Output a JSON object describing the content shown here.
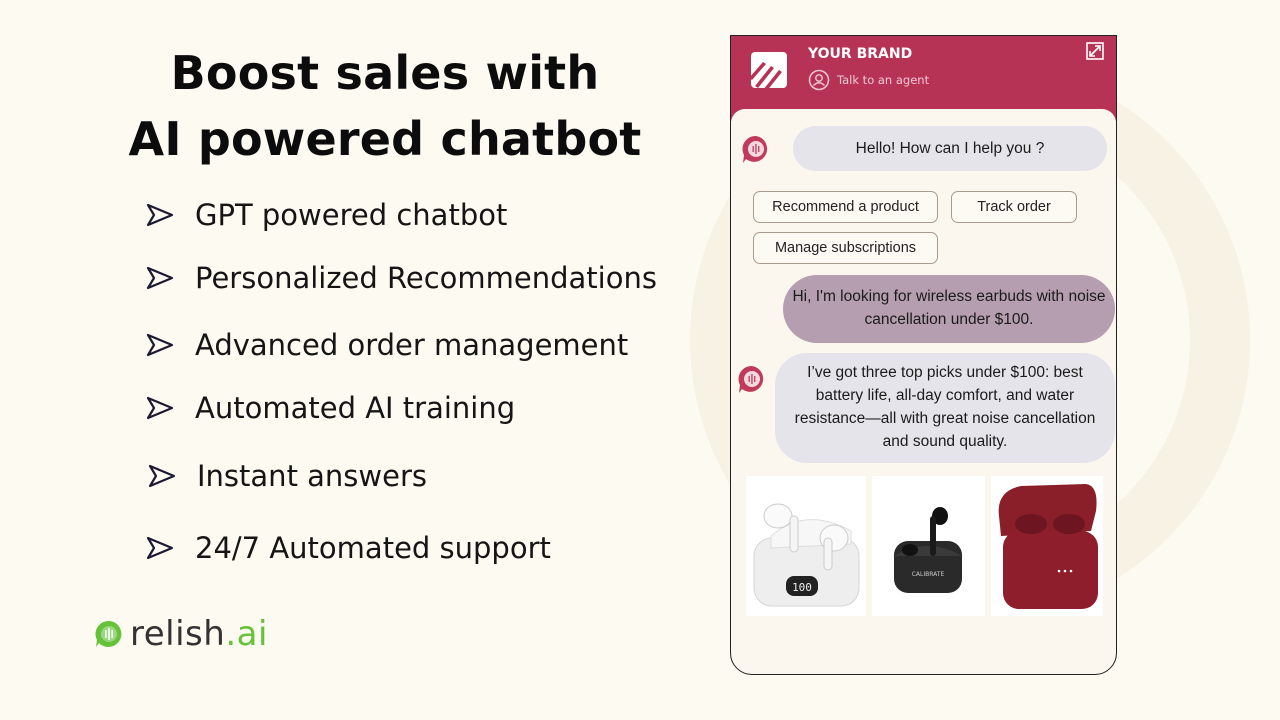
{
  "hero": {
    "title_line1": "Boost sales with",
    "title_line2": "AI powered chatbot"
  },
  "features": [
    {
      "icon": "arrow-right-outline-icon",
      "label": "GPT powered chatbot"
    },
    {
      "icon": "arrow-right-outline-icon",
      "label": "Personalized Recommendations"
    },
    {
      "icon": "arrow-right-outline-icon",
      "label": "Advanced order management"
    },
    {
      "icon": "arrow-right-outline-icon",
      "label": "Automated AI training"
    },
    {
      "icon": "arrow-right-outline-icon",
      "label": "Instant answers"
    },
    {
      "icon": "arrow-right-outline-icon",
      "label": "24/7 Automated support"
    }
  ],
  "logo": {
    "name_main": "relish",
    "name_suffix": ".ai",
    "accent": "#66c23a"
  },
  "chat_widget": {
    "header": {
      "brand_name": "YOUR BRAND",
      "agent_link": "Talk to an agent",
      "color": "#b73355"
    },
    "messages": [
      {
        "sender": "bot",
        "text": "Hello! How can I help you ?"
      },
      {
        "sender": "user",
        "text": "Hi, I'm looking for wireless earbuds with noise cancellation under $100."
      },
      {
        "sender": "bot",
        "text": "I’ve got three top picks under $100: best battery life, all-day comfort, and water resistance—all with great noise cancellation and sound quality."
      }
    ],
    "quick_replies": [
      "Recommend a product",
      "Track order",
      "Manage subscriptions"
    ],
    "products": [
      {
        "name": "White earbuds with LED display case",
        "display": "100"
      },
      {
        "name": "Black earbuds",
        "brand_text": "CALIBRATE"
      },
      {
        "name": "Red earbuds case"
      }
    ]
  }
}
